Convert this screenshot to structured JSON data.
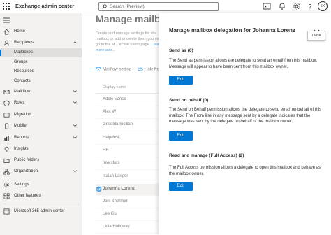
{
  "app": {
    "title": "Exchange admin center",
    "avatar_initials": "SK"
  },
  "search": {
    "placeholder": "Search (Preview)"
  },
  "nav": {
    "items": [
      {
        "label": "Home",
        "icon": "home-icon"
      },
      {
        "label": "Recipients",
        "icon": "people-icon",
        "expanded": true
      },
      {
        "label": "Mailboxes",
        "sub": true,
        "active": true
      },
      {
        "label": "Groups",
        "sub": true
      },
      {
        "label": "Resources",
        "sub": true
      },
      {
        "label": "Contacts",
        "sub": true
      },
      {
        "label": "Mail flow",
        "icon": "mail-flow-icon"
      },
      {
        "label": "Roles",
        "icon": "roles-icon"
      },
      {
        "label": "Migration",
        "icon": "migration-icon"
      },
      {
        "label": "Mobile",
        "icon": "mobile-icon"
      },
      {
        "label": "Reports",
        "icon": "reports-icon"
      },
      {
        "label": "Insights",
        "icon": "insights-icon"
      },
      {
        "label": "Public folders",
        "icon": "folder-icon"
      },
      {
        "label": "Organization",
        "icon": "organization-icon"
      },
      {
        "label": "Settings",
        "icon": "gear-icon"
      },
      {
        "label": "Other features",
        "icon": "other-features-icon"
      },
      {
        "label": "Microsoft 365 admin center",
        "icon": "m365-icon"
      }
    ]
  },
  "main": {
    "title": "Manage mailbox",
    "description": "Create and manage settings for sha... mailbox or add or delete them you must go to the M...",
    "description_tail": "active users page.",
    "learn_more": "Learn more abo...",
    "toolbar": {
      "mailflow_label": "Mailflow setting",
      "hide_label": "Hide fro..."
    },
    "column_header": "Display name",
    "rows": [
      "Adele Vance",
      "Alex W",
      "Griselda Sicilian",
      "Helpdesk",
      "HR",
      "Investors",
      "Isaiah Langer",
      "Johanna Lorenz",
      "Joni Sherman",
      "Lee Gu",
      "Lidia Holloway"
    ],
    "selected_row": "Johanna Lorenz"
  },
  "panel": {
    "title": "Manage mailbox delegation for Johanna Lorenz",
    "close_tooltip": "Close",
    "sections": [
      {
        "title": "Send as (0)",
        "text": "The Send as permission allows the delegate to send an email from this mailbox. Message will appear to have been sent from this mailbox owner.",
        "button": "Edit"
      },
      {
        "title": "Send on behalf (0)",
        "text": "The Send on Behalf permission allows the delegate to send email on behalf of this mailbox. The From line in any message sent by a delegate indicates that the message was sent by the delegate on behalf of the mailbox owner.",
        "button": "Edit"
      },
      {
        "title": "Read and manage (Full Access) (2)",
        "text": "The Full Access permission allows a delegate to open this mailbox and behave as the mailbox owner.",
        "button": "Edit"
      }
    ]
  },
  "colors": {
    "accent": "#0078d4",
    "nav_bg": "#f3f2f1"
  }
}
